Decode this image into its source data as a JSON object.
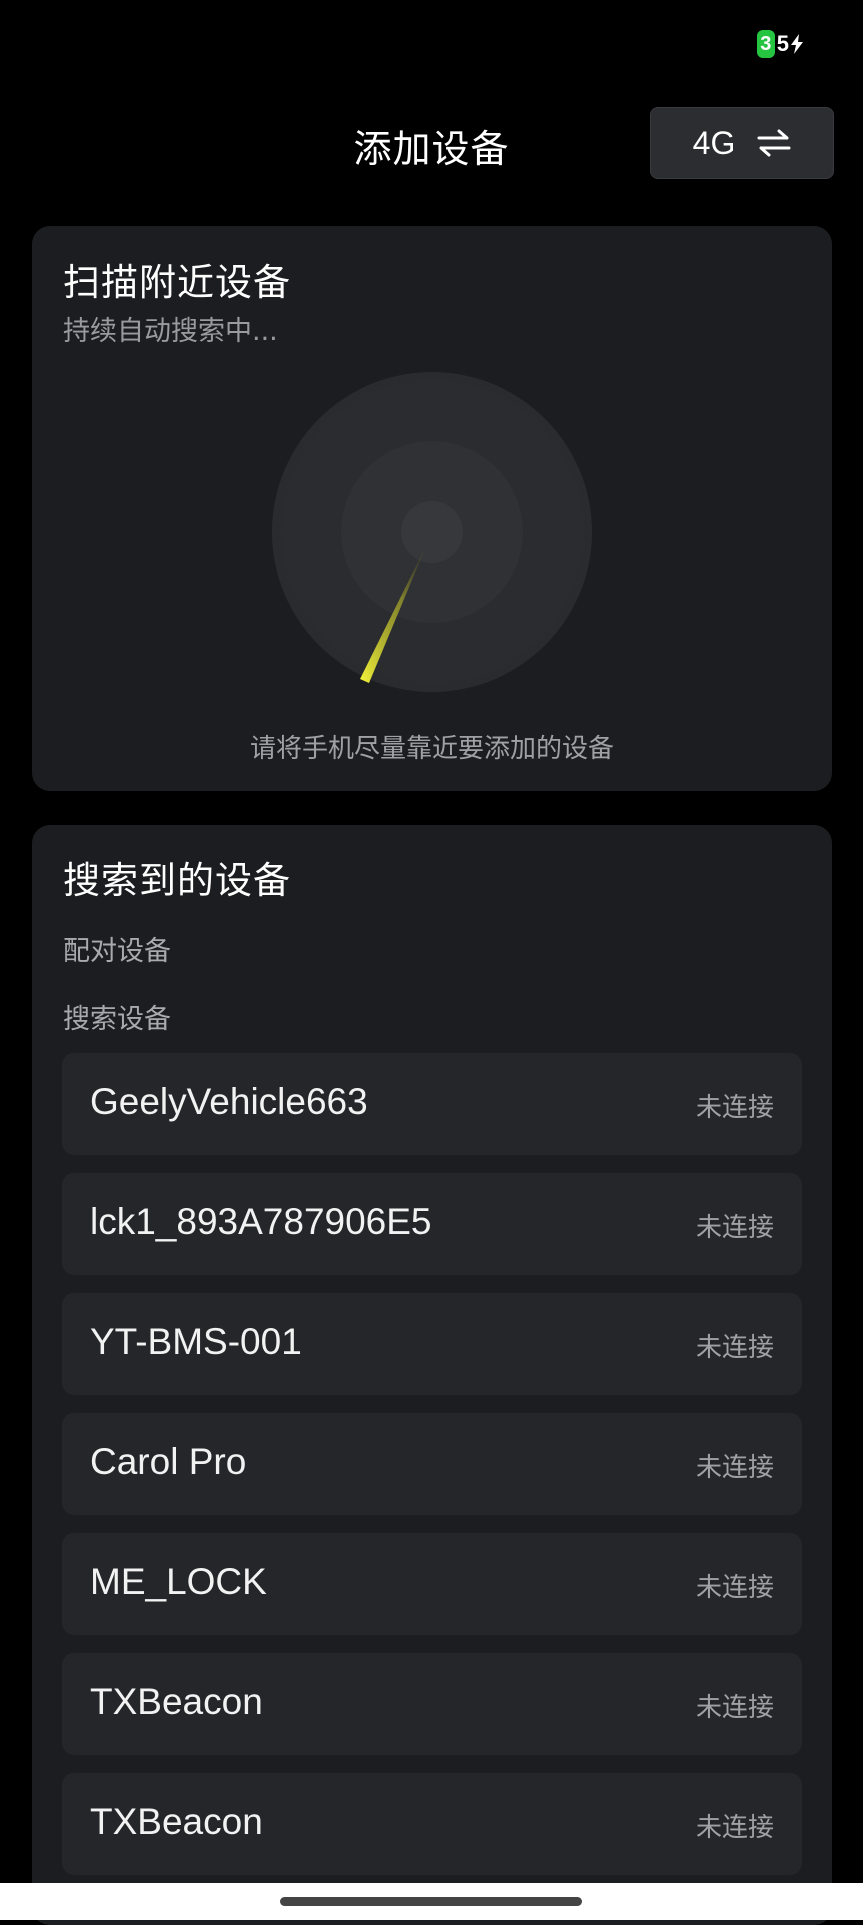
{
  "status_bar": {
    "battery_level_digit": "3",
    "battery_level_rest": "5",
    "charging_icon": "bolt-icon"
  },
  "header": {
    "title": "添加设备",
    "network_label": "4G",
    "network_icon": "swap-arrows-icon"
  },
  "scan": {
    "title": "扫描附近设备",
    "subtitle": "持续自动搜索中...",
    "hint": "请将手机尽量靠近要添加的设备",
    "accent_color": "#e6e62a"
  },
  "found": {
    "title": "搜索到的设备",
    "paired_label": "配对设备",
    "search_label": "搜索设备",
    "devices": [
      {
        "name": "GeelyVehicle663",
        "status": "未连接"
      },
      {
        "name": "lck1_893A787906E5",
        "status": "未连接"
      },
      {
        "name": "YT-BMS-001",
        "status": "未连接"
      },
      {
        "name": "Carol Pro",
        "status": "未连接"
      },
      {
        "name": "ME_LOCK",
        "status": "未连接"
      },
      {
        "name": "TXBeacon",
        "status": "未连接"
      },
      {
        "name": "TXBeacon",
        "status": "未连接"
      }
    ]
  }
}
